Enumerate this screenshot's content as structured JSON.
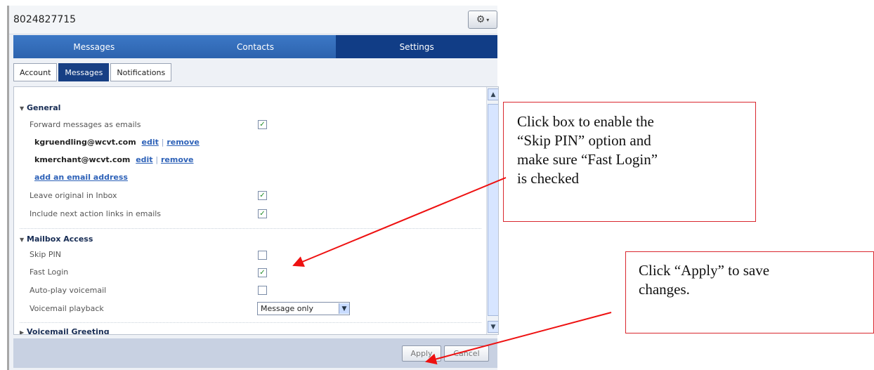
{
  "window": {
    "title": "8024827715",
    "settings_icon": "gear-icon"
  },
  "nav": {
    "tabs": [
      {
        "label": "Messages",
        "active": false
      },
      {
        "label": "Contacts",
        "active": false
      },
      {
        "label": "Settings",
        "active": true
      }
    ]
  },
  "subtabs": [
    {
      "label": "Account",
      "active": false
    },
    {
      "label": "Messages",
      "active": true
    },
    {
      "label": "Notifications",
      "active": false
    }
  ],
  "general": {
    "title": "General",
    "forward_label": "Forward messages as emails",
    "forward_checked": true,
    "emails": [
      {
        "address": "kgruendling@wcvt.com",
        "edit": "edit",
        "separator": "|",
        "remove": "remove"
      },
      {
        "address": "kmerchant@wcvt.com",
        "edit": "edit",
        "separator": "|",
        "remove": "remove"
      }
    ],
    "add_email": "add an email address",
    "leave_original_label": "Leave original in Inbox",
    "leave_original_checked": true,
    "include_links_label": "Include next action links in emails",
    "include_links_checked": true
  },
  "mailbox": {
    "title": "Mailbox Access",
    "skip_pin_label": "Skip PIN",
    "skip_pin_checked": false,
    "fast_login_label": "Fast Login",
    "fast_login_checked": true,
    "autoplay_label": "Auto-play voicemail",
    "autoplay_checked": false,
    "playback_label": "Voicemail playback",
    "playback_value": "Message only"
  },
  "voicemail_greeting": {
    "title": "Voicemail Greeting"
  },
  "buttons": {
    "apply": "Apply",
    "cancel": "Cancel"
  },
  "callouts": {
    "first": {
      "line1": "Click box to enable the",
      "line2": "“Skip PIN” option and",
      "line3": "make sure “Fast Login”",
      "line4": "is checked"
    },
    "second": {
      "line1": "Click “Apply” to save",
      "line2": "changes."
    }
  },
  "colors": {
    "nav_blue": "#2d63ae",
    "active_tab": "#113d86",
    "callout_red": "#d9272e",
    "link_blue": "#2e62b8"
  }
}
